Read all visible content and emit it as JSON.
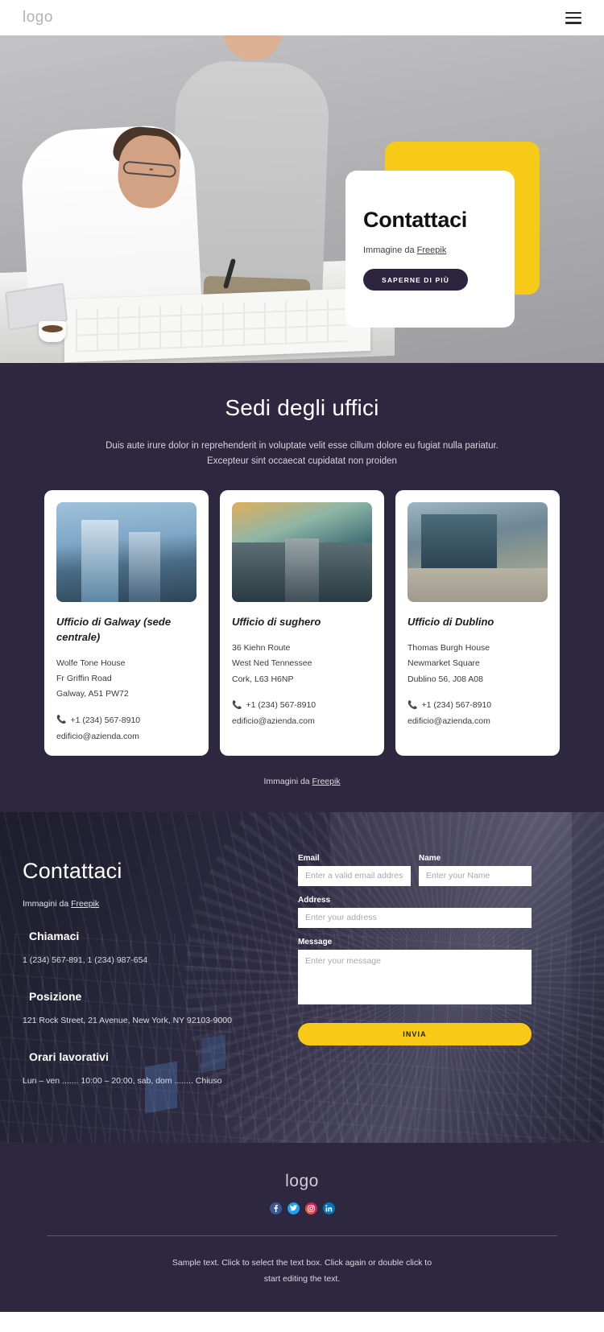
{
  "theme": {
    "dark": "#2d2740",
    "yellow": "#f6ca16",
    "white": "#ffffff"
  },
  "header": {
    "logo": "logo",
    "menu_icon": "hamburger-icon"
  },
  "hero": {
    "title": "Contattaci",
    "credit_prefix": "Immagine da ",
    "credit_link": "Freepik",
    "cta": "SAPERNE DI PIÙ"
  },
  "offices": {
    "heading": "Sedi degli uffici",
    "subtitle_line1": "Duis aute irure dolor in reprehenderit in voluptate velit esse cillum dolore eu fugiat nulla pariatur.",
    "subtitle_line2": "Excepteur sint occaecat cupidatat non proiden",
    "credit_prefix": "Immagini da ",
    "credit_link": "Freepik",
    "cards": [
      {
        "name": "Ufficio di Galway (sede centrale)",
        "address_lines": [
          "Wolfe Tone House",
          "Fr Griffin Road",
          "Galway, A51 PW72"
        ],
        "phone": "+1 (234) 567-8910",
        "email": "edificio@azienda.com"
      },
      {
        "name": "Ufficio di sughero",
        "address_lines": [
          "36 Kiehn Route",
          "West Ned Tennessee",
          "Cork, L63 H6NP"
        ],
        "phone": "+1 (234) 567-8910",
        "email": "edificio@azienda.com"
      },
      {
        "name": "Ufficio di Dublino",
        "address_lines": [
          "Thomas Burgh House",
          "Newmarket Square",
          "Dublino 56, J08 A08"
        ],
        "phone": "+1 (234) 567-8910",
        "email": "edificio@azienda.com"
      }
    ]
  },
  "contact": {
    "heading": "Contattaci",
    "credit_prefix": "Immagini da ",
    "credit_link": "Freepik",
    "blocks": [
      {
        "title": "Chiamaci",
        "text": "1 (234) 567-891, 1 (234) 987-654"
      },
      {
        "title": "Posizione",
        "text": "121 Rock Street, 21 Avenue, New York, NY 92103-9000"
      },
      {
        "title": "Orari lavorativi",
        "text": "Lun – ven ....... 10:00 – 20:00, sab, dom ........ Chiuso"
      }
    ],
    "form": {
      "email_label": "Email",
      "email_placeholder": "Enter a valid email address",
      "name_label": "Name",
      "name_placeholder": "Enter your Name",
      "address_label": "Address",
      "address_placeholder": "Enter your address",
      "message_label": "Message",
      "message_placeholder": "Enter your message",
      "submit": "INVIA"
    }
  },
  "footer": {
    "logo": "logo",
    "socials": [
      "facebook-icon",
      "twitter-icon",
      "instagram-icon",
      "linkedin-icon"
    ],
    "note_line1": "Sample text. Click to select the text box. Click again or double click to",
    "note_line2": "start editing the text."
  }
}
